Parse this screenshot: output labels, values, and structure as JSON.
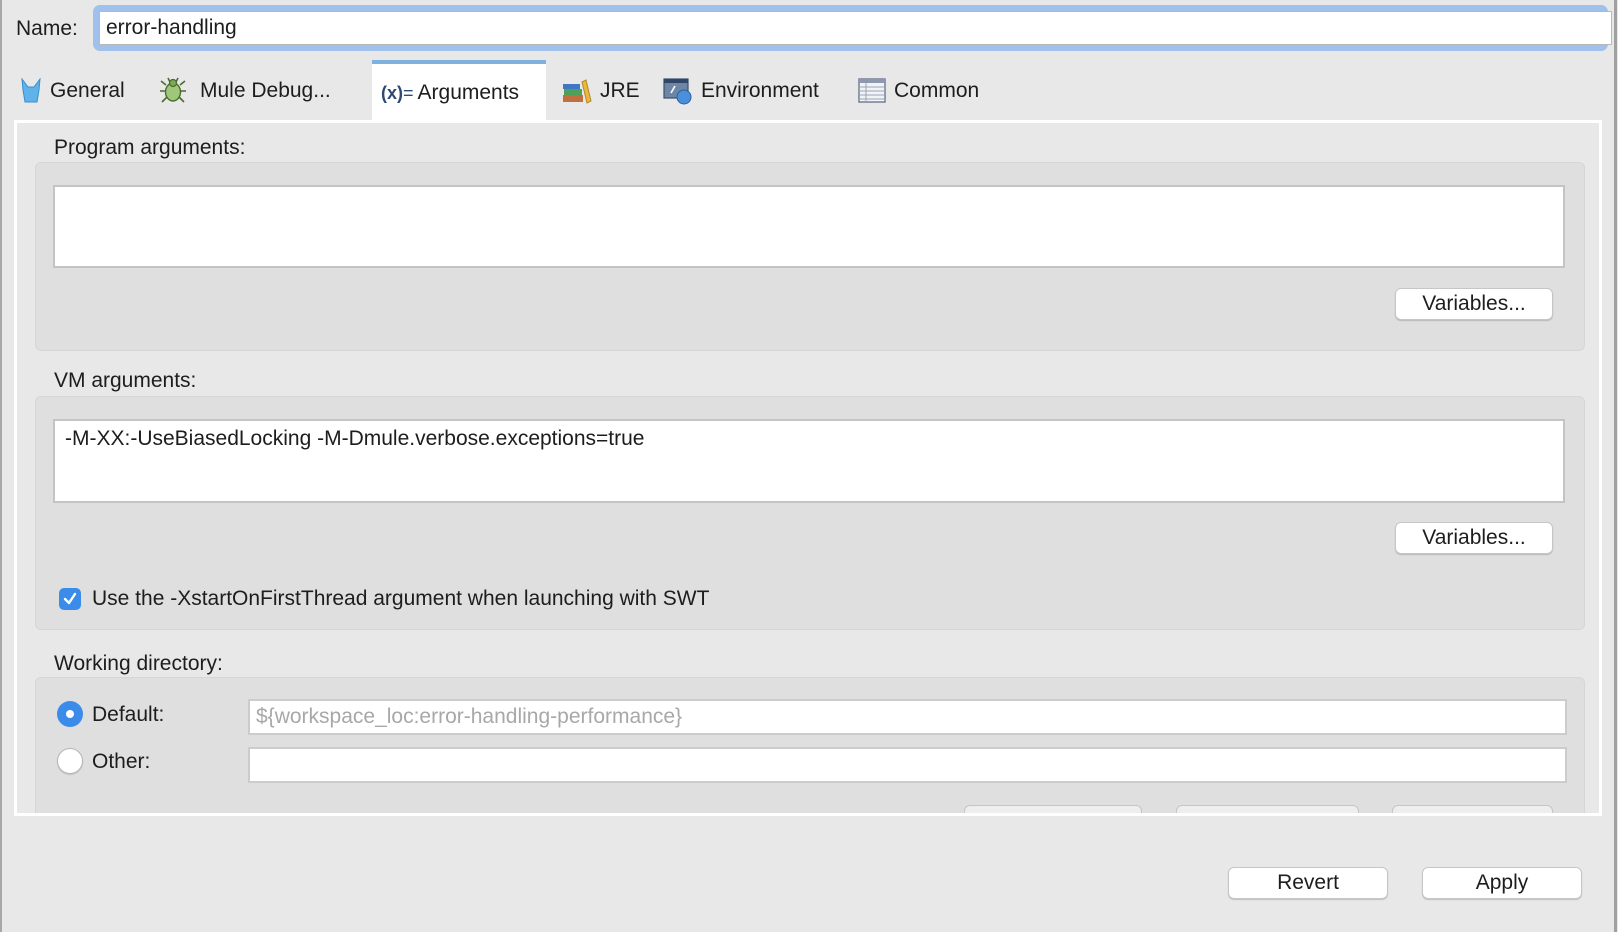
{
  "name_field": {
    "label": "Name:",
    "value": "error-handling"
  },
  "tabs": [
    {
      "label": "General",
      "icon": "general-icon"
    },
    {
      "label": "Mule Debug...",
      "icon": "bug-icon"
    },
    {
      "label": "Arguments",
      "icon": "arguments-icon",
      "active": true
    },
    {
      "label": "JRE",
      "icon": "library-books-icon"
    },
    {
      "label": "Environment",
      "icon": "environment-icon"
    },
    {
      "label": "Common",
      "icon": "table-icon"
    }
  ],
  "program_arguments": {
    "label": "Program arguments:",
    "value": "",
    "variables_button": "Variables..."
  },
  "vm_arguments": {
    "label": "VM arguments:",
    "value": "-M-XX:-UseBiasedLocking -M-Dmule.verbose.exceptions=true",
    "variables_button": "Variables..."
  },
  "swt_checkbox": {
    "label": "Use the -XstartOnFirstThread argument when launching with SWT",
    "checked": true
  },
  "working_directory": {
    "label": "Working directory:",
    "default_label": "Default:",
    "default_selected": true,
    "default_placeholder": "${workspace_loc:error-handling-performance}",
    "other_label": "Other:",
    "other_value": ""
  },
  "footer": {
    "revert": "Revert",
    "apply": "Apply"
  },
  "colors": {
    "accent": "#3b8beb",
    "focus_ring": "#9fc1ec",
    "active_tab_bar": "#7fb1df"
  }
}
